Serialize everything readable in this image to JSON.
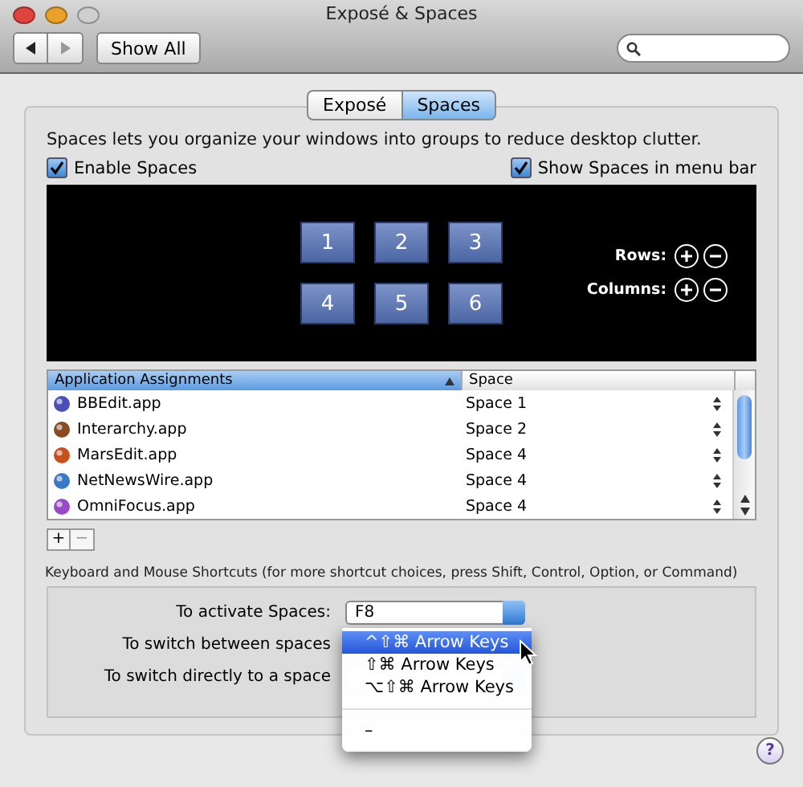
{
  "window": {
    "title": "Exposé & Spaces"
  },
  "toolbar": {
    "show_all": "Show All"
  },
  "tabs": [
    {
      "label": "Exposé",
      "selected": false
    },
    {
      "label": "Spaces",
      "selected": true
    }
  ],
  "description": "Spaces lets you organize your windows into groups to reduce desktop clutter.",
  "checkboxes": [
    {
      "label": "Enable Spaces",
      "checked": true
    },
    {
      "label": "Show Spaces in menu bar",
      "checked": true
    }
  ],
  "spaces": [
    "1",
    "2",
    "3",
    "4",
    "5",
    "6"
  ],
  "grid_controls": [
    {
      "label": "Rows:"
    },
    {
      "label": "Columns:"
    }
  ],
  "table": {
    "columns": [
      "Application Assignments",
      "Space"
    ],
    "rows": [
      {
        "app": "BBEdit.app",
        "space": "Space 1",
        "color": "#4b4fb8"
      },
      {
        "app": "Interarchy.app",
        "space": "Space 2",
        "color": "#8a4a22"
      },
      {
        "app": "MarsEdit.app",
        "space": "Space 4",
        "color": "#c8501e"
      },
      {
        "app": "NetNewsWire.app",
        "space": "Space 4",
        "color": "#3a78c8"
      },
      {
        "app": "OmniFocus.app",
        "space": "Space 4",
        "color": "#9a4ac8"
      }
    ]
  },
  "list_buttons": [
    "+",
    "−"
  ],
  "shortcuts": {
    "heading": "Keyboard and Mouse Shortcuts (for more shortcut choices, press Shift, Control, Option, or Command)",
    "rows": [
      {
        "label": "To activate Spaces:",
        "value": "F8"
      },
      {
        "label": "To switch between spaces"
      },
      {
        "label": "To switch directly to a space"
      }
    ]
  },
  "menu": {
    "items": [
      {
        "label": "^⇧⌘ Arrow Keys",
        "selected": true
      },
      {
        "label": "⇧⌘ Arrow Keys",
        "selected": false
      },
      {
        "label": "⌥⇧⌘ Arrow Keys",
        "selected": false
      },
      {
        "kind": "separator"
      },
      {
        "label": "–",
        "selected": false
      }
    ]
  },
  "help": "?"
}
